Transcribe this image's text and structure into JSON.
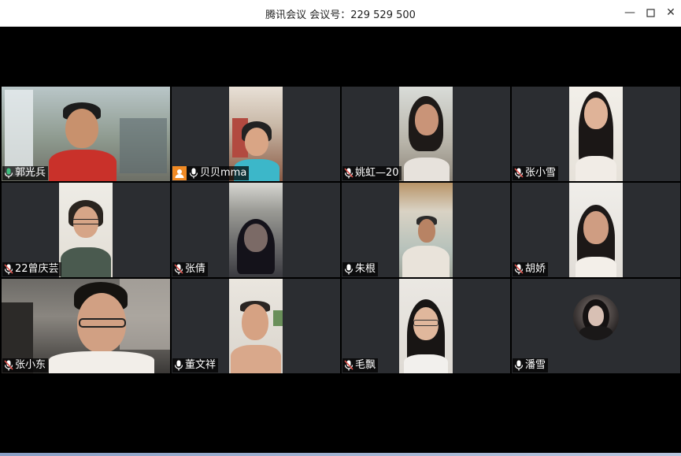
{
  "window": {
    "title": "腾讯会议 会议号：229 529 500",
    "minimize_glyph": "—",
    "maximize_glyph": "☐",
    "close_glyph": "✕"
  },
  "colors": {
    "active_speaker_border": "#3fbf7f",
    "muted_mic": "#e0504a",
    "host_badge": "#f08a24"
  },
  "participants": [
    {
      "name": "郭光兵",
      "mic": "active",
      "active_speaker": true
    },
    {
      "name": "贝贝mma",
      "mic": "on",
      "host_badge": true
    },
    {
      "name": "姚虹—20",
      "mic": "muted"
    },
    {
      "name": "张小雪",
      "mic": "muted"
    },
    {
      "name": "22曾庆芸",
      "mic": "muted"
    },
    {
      "name": "张倩",
      "mic": "muted"
    },
    {
      "name": "朱根",
      "mic": "on"
    },
    {
      "name": "胡娇",
      "mic": "muted"
    },
    {
      "name": "张小东",
      "mic": "muted"
    },
    {
      "name": "董文祥",
      "mic": "on"
    },
    {
      "name": "毛飘",
      "mic": "muted"
    },
    {
      "name": "潘雪",
      "mic": "on",
      "video": "off"
    }
  ],
  "icons": {
    "mic_on": "microphone-icon",
    "mic_muted": "microphone-muted-icon",
    "host": "user-badge-icon"
  }
}
